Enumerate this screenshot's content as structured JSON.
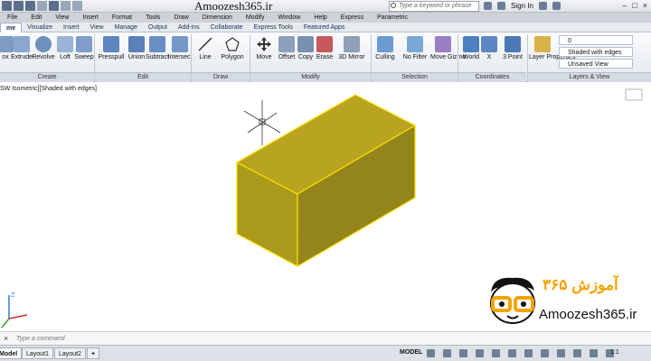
{
  "window": {
    "title": "Amoozesh365.ir",
    "search_placeholder": "Type a keyword or phrase",
    "sign_in": "Sign In"
  },
  "menu": [
    "File",
    "Edit",
    "View",
    "Insert",
    "Format",
    "Tools",
    "Draw",
    "Dimension",
    "Modify",
    "Window",
    "Help",
    "Express",
    "Parametric"
  ],
  "ribbon_tabs": [
    "me",
    "Visualize",
    "Insert",
    "View",
    "Manage",
    "Output",
    "Add-ins",
    "Collaborate",
    "Express Tools",
    "Featured Apps"
  ],
  "ribbon": {
    "create": {
      "label": "Create",
      "buttons": [
        "ox",
        "Extrude",
        "Revolve",
        "Loft",
        "Sweep"
      ]
    },
    "edit": {
      "label": "Edit",
      "buttons": [
        "Presspull",
        "Union",
        "Subtract",
        "Intersect"
      ]
    },
    "draw": {
      "label": "Draw",
      "buttons": [
        "Line",
        "Polygon"
      ]
    },
    "modify": {
      "label": "Modify",
      "buttons": [
        "Move",
        "Offset",
        "Copy",
        "Erase",
        "3D Mirror"
      ]
    },
    "selection": {
      "label": "Selection",
      "buttons": [
        "Culling",
        "No Filter",
        "Move Gizmo"
      ]
    },
    "coordinates": {
      "label": "Coordinates",
      "buttons": [
        "World",
        "X",
        "3 Point"
      ]
    },
    "layers": {
      "label": "Layers & View",
      "layer_properties": "Layer Properties",
      "layer_value": "0",
      "visual_style": "Shaded with edges",
      "view": "Unsaved View"
    }
  },
  "viewport": {
    "label": "SW Isometric][Shaded with edges]"
  },
  "command": {
    "placeholder": "Type a command"
  },
  "status": {
    "tabs": [
      "Model",
      "Layout1",
      "Layout2"
    ],
    "model_label": "MODEL",
    "scale": "1:1"
  },
  "watermark": {
    "persian": "آموزش ۳۶۵",
    "site": "Amoozesh365.ir"
  },
  "colors": {
    "solid_front": "#a99a1b",
    "solid_top": "#b8a420",
    "solid_side": "#93851a",
    "edge": "#ffde00",
    "accent": "#f5a300"
  }
}
